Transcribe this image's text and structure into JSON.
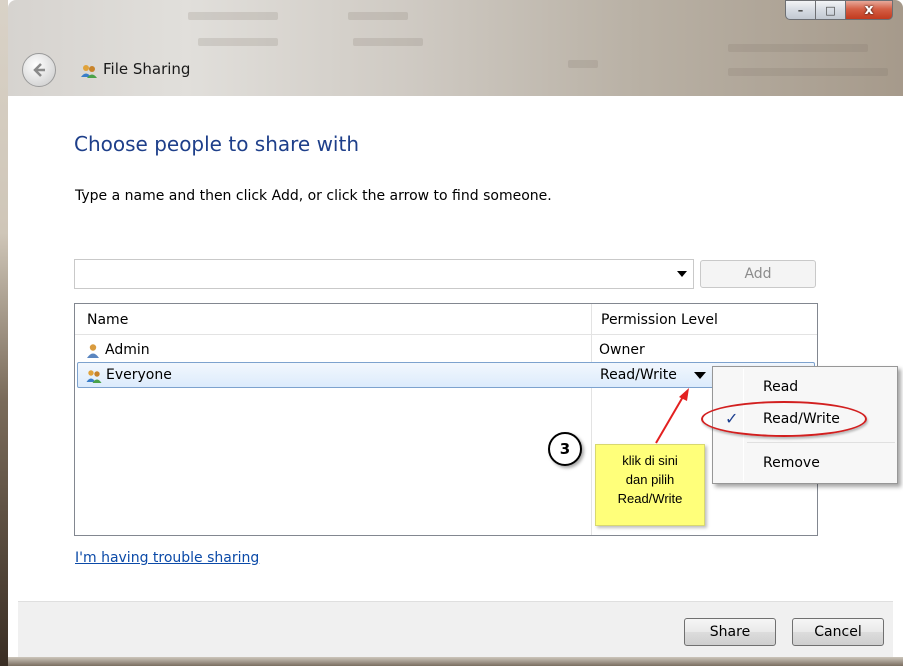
{
  "window": {
    "title": "File Sharing",
    "caption_min": "–",
    "caption_max": "□",
    "caption_close": "x"
  },
  "content": {
    "heading": "Choose people to share with",
    "instruction": "Type a name and then click Add, or click the arrow to find someone.",
    "name_input_value": "",
    "add_label": "Add"
  },
  "list": {
    "columns": [
      "Name",
      "Permission Level"
    ],
    "rows": [
      {
        "name": "Admin",
        "permission": "Owner",
        "icon": "user-icon",
        "selected": false
      },
      {
        "name": "Everyone",
        "permission": "Read/Write",
        "icon": "group-icon",
        "selected": true
      }
    ]
  },
  "menu": {
    "items": [
      {
        "label": "Read",
        "checked": false
      },
      {
        "label": "Read/Write",
        "checked": true,
        "check_glyph": "✓"
      },
      {
        "label": "Remove",
        "checked": false
      }
    ]
  },
  "trouble_link": "I'm having trouble sharing",
  "footer": {
    "share_label": "Share",
    "cancel_label": "Cancel"
  },
  "annotation": {
    "step_number": "3",
    "note_lines": [
      "klik di sini",
      "dan pilih",
      "Read/Write"
    ],
    "arrow_color": "#e32020",
    "ellipse_color": "#d21f1f",
    "note_color": "#ffff7a"
  },
  "colors": {
    "heading": "#1e3f8a",
    "link": "#0b4aa8",
    "selection": "#dcebfc"
  }
}
